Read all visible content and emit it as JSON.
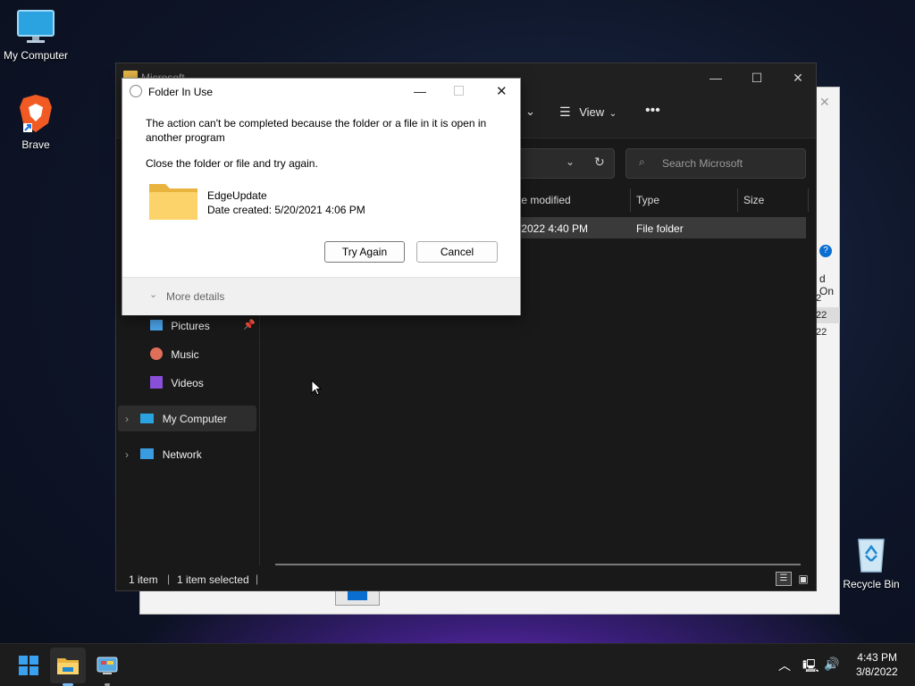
{
  "desktop": {
    "icons": [
      {
        "label": "My Computer"
      },
      {
        "label": "Brave"
      },
      {
        "label": "Recycle Bin"
      }
    ]
  },
  "explorer": {
    "title": "Microsoft",
    "toolbar": {
      "view_label": "View",
      "more_label": "•••"
    },
    "search_placeholder": "Search Microsoft",
    "columns": [
      "te modified",
      "Type",
      "Size"
    ],
    "row": {
      "date": "/2022 4:40 PM",
      "type": "File folder"
    },
    "nav": [
      {
        "label": "Pictures"
      },
      {
        "label": "Music"
      },
      {
        "label": "Videos"
      },
      {
        "label": "My Computer"
      },
      {
        "label": "Network"
      }
    ],
    "status": {
      "items": "1 item",
      "selected": "1 item selected"
    }
  },
  "bg_window": {
    "col_label": "d On",
    "vals": [
      "2",
      "22",
      "22"
    ]
  },
  "dialog": {
    "title": "Folder In Use",
    "message": "The action can't be completed because the folder or a file in it is open in another program",
    "instruction": "Close the folder or file and try again.",
    "item_name": "EdgeUpdate",
    "item_date": "Date created: 5/20/2021 4:06 PM",
    "try_again": "Try Again",
    "cancel": "Cancel",
    "more_details": "More details"
  },
  "taskbar": {
    "time": "4:43 PM",
    "date": "3/8/2022"
  },
  "colors": {
    "accent": "#0078d4",
    "folder": "#f5c542"
  }
}
